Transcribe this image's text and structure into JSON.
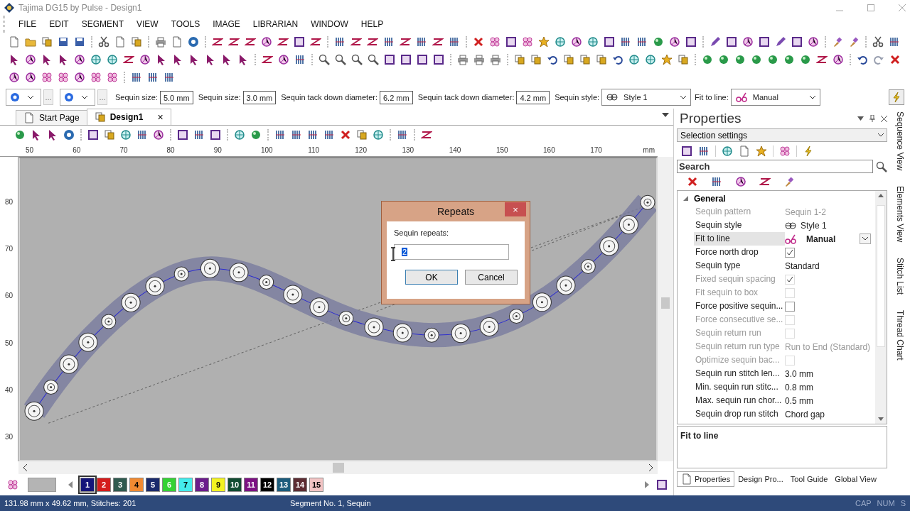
{
  "window": {
    "title": "Tajima DG15 by Pulse - Design1"
  },
  "menu": [
    "FILE",
    "EDIT",
    "SEGMENT",
    "VIEW",
    "TOOLS",
    "IMAGE",
    "LIBRARIAN",
    "WINDOW",
    "HELP"
  ],
  "options": [
    {
      "kind": "icon-dropdown"
    },
    {
      "kind": "more",
      "label": "..."
    },
    {
      "kind": "icon-dropdown"
    },
    {
      "kind": "more",
      "label": "..."
    },
    {
      "kind": "field",
      "label": "Sequin size:",
      "value": "5.0 mm"
    },
    {
      "kind": "field",
      "label": "Sequin size:",
      "value": "3.0 mm"
    },
    {
      "kind": "field",
      "label": "Sequin tack down diameter:",
      "value": "6.2 mm"
    },
    {
      "kind": "field",
      "label": "Sequin tack down diameter:",
      "value": "4.2 mm"
    },
    {
      "kind": "select",
      "label": "Sequin style:",
      "value": "Style 1"
    },
    {
      "kind": "select",
      "label": "Fit to line:",
      "value": "Manual"
    },
    {
      "kind": "action"
    }
  ],
  "doc_tabs": [
    {
      "label": "Start Page",
      "selected": false
    },
    {
      "label": "Design1",
      "selected": true,
      "close": "×"
    }
  ],
  "ruler": {
    "x_labels": [
      "50",
      "60",
      "70",
      "80",
      "90",
      "100",
      "110",
      "120",
      "130",
      "140",
      "150",
      "160",
      "170"
    ],
    "unit": "mm",
    "y_labels": [
      "80",
      "70",
      "60",
      "50",
      "40",
      "30"
    ]
  },
  "dialog": {
    "title": "Repeats",
    "close": "×",
    "label": "Sequin repeats:",
    "value": "2",
    "buttons": [
      "OK",
      "Cancel"
    ]
  },
  "palette": [
    {
      "label": "1",
      "color": "#15157a",
      "selected": true
    },
    {
      "label": "2",
      "color": "#d41c1c",
      "selected": false
    },
    {
      "label": "3",
      "color": "#2f5a4f",
      "selected": false
    },
    {
      "label": "4",
      "color": "#f08a32",
      "selected": false
    },
    {
      "label": "5",
      "color": "#1b2b6c",
      "selected": false
    },
    {
      "label": "6",
      "color": "#34d234",
      "selected": false
    },
    {
      "label": "7",
      "color": "#44ecec",
      "selected": false
    },
    {
      "label": "8",
      "color": "#6c1c8c",
      "selected": false
    },
    {
      "label": "9",
      "color": "#f2f222",
      "selected": false
    },
    {
      "label": "10",
      "color": "#124c32",
      "selected": false
    },
    {
      "label": "11",
      "color": "#7c1282",
      "selected": false
    },
    {
      "label": "12",
      "color": "#000000",
      "selected": false
    },
    {
      "label": "13",
      "color": "#1c5c7c",
      "selected": false
    },
    {
      "label": "14",
      "color": "#5c2c32",
      "selected": false
    },
    {
      "label": "15",
      "color": "#f2c4c4",
      "selected": false
    }
  ],
  "properties": {
    "title": "Properties",
    "selector": "Selection settings",
    "search": {
      "value": "Search"
    },
    "category": {
      "label": "General",
      "expanded": true
    },
    "rows": [
      {
        "label": "Sequin pattern",
        "value": "Sequin 1-2",
        "kind": "text",
        "disabled": true,
        "selected": false
      },
      {
        "label": "Sequin style",
        "value": "Style 1",
        "kind": "style",
        "disabled": false,
        "selected": false
      },
      {
        "label": "Fit to line",
        "value": "Manual",
        "kind": "dropdown",
        "disabled": false,
        "selected": true
      },
      {
        "label": "Force north drop",
        "kind": "check",
        "checked": true,
        "disabled": false,
        "selected": false
      },
      {
        "label": "Sequin type",
        "value": "Standard",
        "kind": "text",
        "disabled": false,
        "selected": false
      },
      {
        "label": "Fixed sequin spacing",
        "kind": "check",
        "checked": true,
        "disabled": true,
        "selected": false
      },
      {
        "label": "Fit sequin to box",
        "kind": "check",
        "checked": false,
        "disabled": true,
        "selected": false
      },
      {
        "label": "Force positive sequin...",
        "kind": "check",
        "checked": false,
        "disabled": false,
        "selected": false
      },
      {
        "label": "Force consecutive se...",
        "kind": "check",
        "checked": false,
        "disabled": true,
        "selected": false
      },
      {
        "label": "Sequin return run",
        "kind": "check",
        "checked": false,
        "disabled": true,
        "selected": false
      },
      {
        "label": "Sequin return run type",
        "value": "Run to End (Standard)",
        "kind": "text",
        "disabled": true,
        "selected": false
      },
      {
        "label": "Optimize sequin bac...",
        "kind": "check",
        "checked": false,
        "disabled": true,
        "selected": false
      },
      {
        "label": "Sequin run stitch len...",
        "value": "3.0 mm",
        "kind": "text",
        "disabled": false,
        "selected": false
      },
      {
        "label": "Min. sequin run stitc...",
        "value": "0.8 mm",
        "kind": "text",
        "disabled": false,
        "selected": false
      },
      {
        "label": "Max. sequin run chor...",
        "value": "0.5 mm",
        "kind": "text",
        "disabled": false,
        "selected": false
      },
      {
        "label": "Sequin drop run stitch",
        "value": "Chord gap",
        "kind": "text",
        "disabled": false,
        "selected": false
      }
    ],
    "description": "Fit to line",
    "tabs": [
      {
        "label": "Properties",
        "selected": true
      },
      {
        "label": "Design Pro...",
        "selected": false
      },
      {
        "label": "Tool Guide",
        "selected": false
      },
      {
        "label": "Global View",
        "selected": false
      }
    ]
  },
  "side_tabs": [
    "Sequence View",
    "Elements View",
    "Stitch List",
    "Thread Chart"
  ],
  "status_bar": {
    "size": "131.98 mm x 49.62 mm, Stitches: 201",
    "segment": "Segment No. 1, Sequin",
    "indicators": [
      "CAP",
      "NUM",
      "S"
    ]
  }
}
